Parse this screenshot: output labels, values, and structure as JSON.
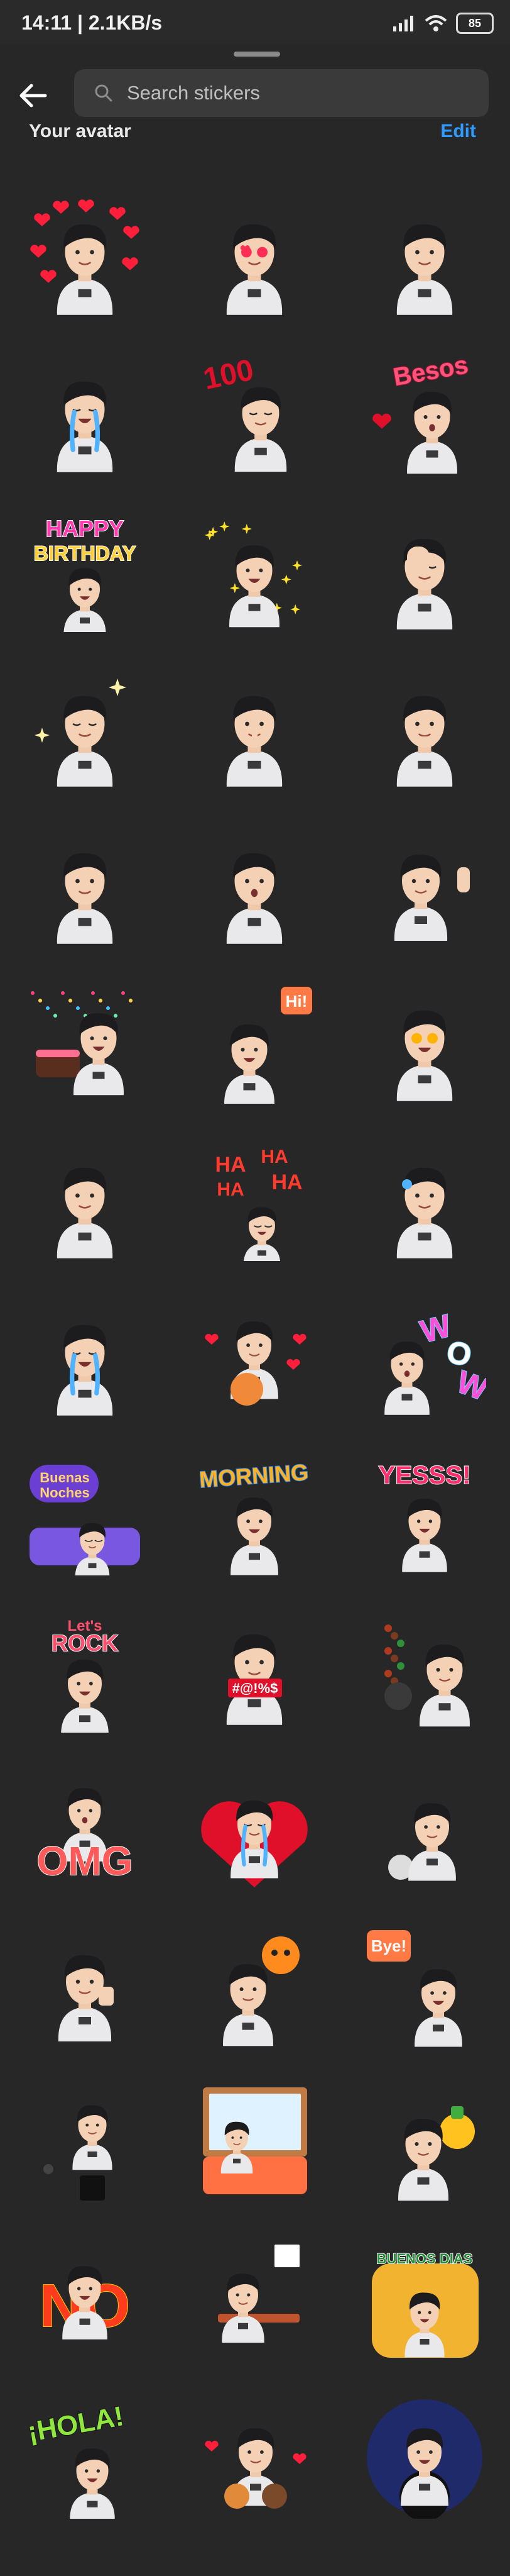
{
  "status_bar": {
    "time_speed": "14:11 | 2.1KB/s",
    "battery": "85"
  },
  "header": {
    "search_placeholder": "Search stickers",
    "section_title": "Your avatar",
    "edit_label": "Edit"
  },
  "colors": {
    "background": "#272727",
    "accent": "#2f9bff",
    "search_bg": "#3a3a3a"
  },
  "stickers": [
    {
      "name": "hearts-floating"
    },
    {
      "name": "heart-eyes"
    },
    {
      "name": "smiling"
    },
    {
      "name": "tears-of-joy"
    },
    {
      "name": "hundred-pointing",
      "text": "100"
    },
    {
      "name": "besos-kiss",
      "text": "Besos"
    },
    {
      "name": "happy-birthday",
      "text": "HAPPY BIRTHDAY"
    },
    {
      "name": "sparkles-celebrate"
    },
    {
      "name": "facepalm"
    },
    {
      "name": "sparkles-proud"
    },
    {
      "name": "shush"
    },
    {
      "name": "thinking"
    },
    {
      "name": "neutral"
    },
    {
      "name": "surprised"
    },
    {
      "name": "waving-leaning"
    },
    {
      "name": "birthday-cake"
    },
    {
      "name": "hi-bubble",
      "text": "Hi!"
    },
    {
      "name": "star-struck"
    },
    {
      "name": "worried"
    },
    {
      "name": "haha-laughing",
      "text": "HA HA HA HA"
    },
    {
      "name": "nervous-sweat"
    },
    {
      "name": "crying"
    },
    {
      "name": "cat-hug"
    },
    {
      "name": "wow",
      "text": "WOW"
    },
    {
      "name": "buenas-noches",
      "text": "Buenas Noches"
    },
    {
      "name": "morning",
      "text": "MORNING"
    },
    {
      "name": "yesss",
      "text": "YESSS!"
    },
    {
      "name": "lets-rock",
      "text": "Let's ROCK"
    },
    {
      "name": "censored-swear",
      "text": "#@!%$"
    },
    {
      "name": "cooking-wok"
    },
    {
      "name": "omg",
      "text": "OMG"
    },
    {
      "name": "broken-heart"
    },
    {
      "name": "running"
    },
    {
      "name": "thumbs-up"
    },
    {
      "name": "balloon-sad"
    },
    {
      "name": "bye-bubble",
      "text": "Bye!"
    },
    {
      "name": "mic-drop"
    },
    {
      "name": "window-bed"
    },
    {
      "name": "pineapple"
    },
    {
      "name": "no-fire",
      "text": "NO"
    },
    {
      "name": "desk-work"
    },
    {
      "name": "buenos-dias",
      "text": "BUENOS DIAS"
    },
    {
      "name": "hola",
      "text": "¡HOLA!"
    },
    {
      "name": "pet-friends"
    },
    {
      "name": "dj-night"
    }
  ]
}
